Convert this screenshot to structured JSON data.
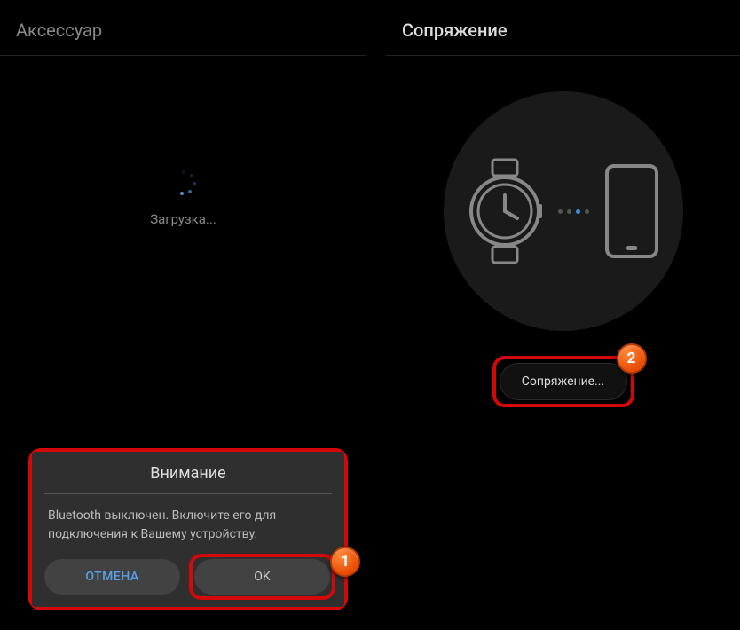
{
  "left": {
    "title": "Аксессуар",
    "loading": "Загрузка..."
  },
  "dialog": {
    "title": "Внимание",
    "message": "Bluetooth выключен. Включите его для подключения к Вашему устройству.",
    "cancel": "ОТМЕНА",
    "ok": "OK"
  },
  "right": {
    "title": "Сопряжение",
    "pair_button": "Сопряжение..."
  },
  "badges": {
    "one": "1",
    "two": "2"
  }
}
